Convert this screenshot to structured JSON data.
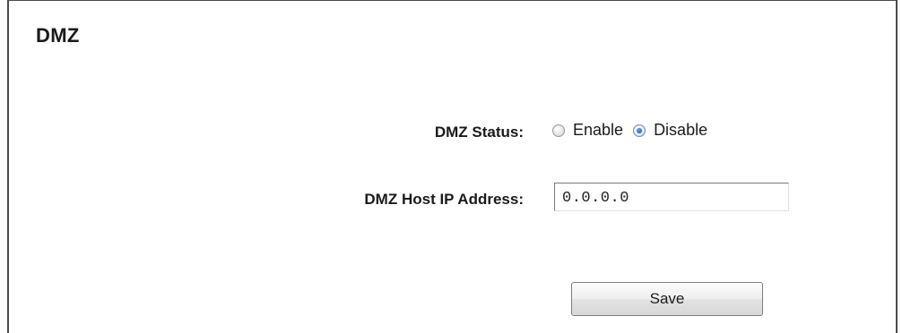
{
  "page": {
    "title": "DMZ"
  },
  "form": {
    "status": {
      "label": "DMZ Status:",
      "options": [
        {
          "label": "Enable",
          "checked": false
        },
        {
          "label": "Disable",
          "checked": true
        }
      ]
    },
    "host_ip": {
      "label": "DMZ Host IP Address:",
      "value": "0.0.0.0"
    },
    "save_label": "Save"
  }
}
